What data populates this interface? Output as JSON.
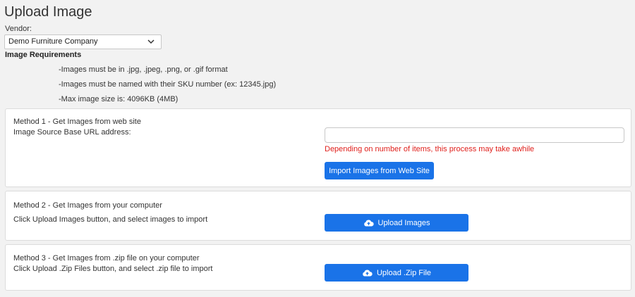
{
  "page": {
    "title": "Upload Image"
  },
  "vendor": {
    "label": "Vendor:",
    "selected": "Demo Furniture Company",
    "icon": "chevron-down-icon"
  },
  "requirements": {
    "heading": "Image Requirements",
    "lines": [
      "-Images must be in .jpg, .jpeg, .png, or .gif format",
      "-Images must be named with their SKU number (ex: 12345.jpg)",
      "-Max image size is: 4096KB (4MB)"
    ]
  },
  "method1": {
    "title": "Method 1 - Get Images from web site",
    "field_label": "Image Source Base URL address:",
    "url_value": "",
    "warning": "Depending on number of items, this process may take awhile",
    "button": "Import Images from Web Site"
  },
  "method2": {
    "title": "Method 2 - Get Images from your computer",
    "instruction": "Click Upload Images button, and select images to import",
    "button": "Upload Images",
    "icon": "cloud-upload-icon"
  },
  "method3": {
    "title": "Method 3 - Get Images from .zip file on your computer",
    "instruction": "Click Upload .Zip Files button, and select .zip file to import",
    "button": "Upload .Zip File",
    "icon": "cloud-upload-icon"
  },
  "colors": {
    "primary": "#1a73e8",
    "warning": "#e0201c",
    "background": "#f2f2f2"
  }
}
